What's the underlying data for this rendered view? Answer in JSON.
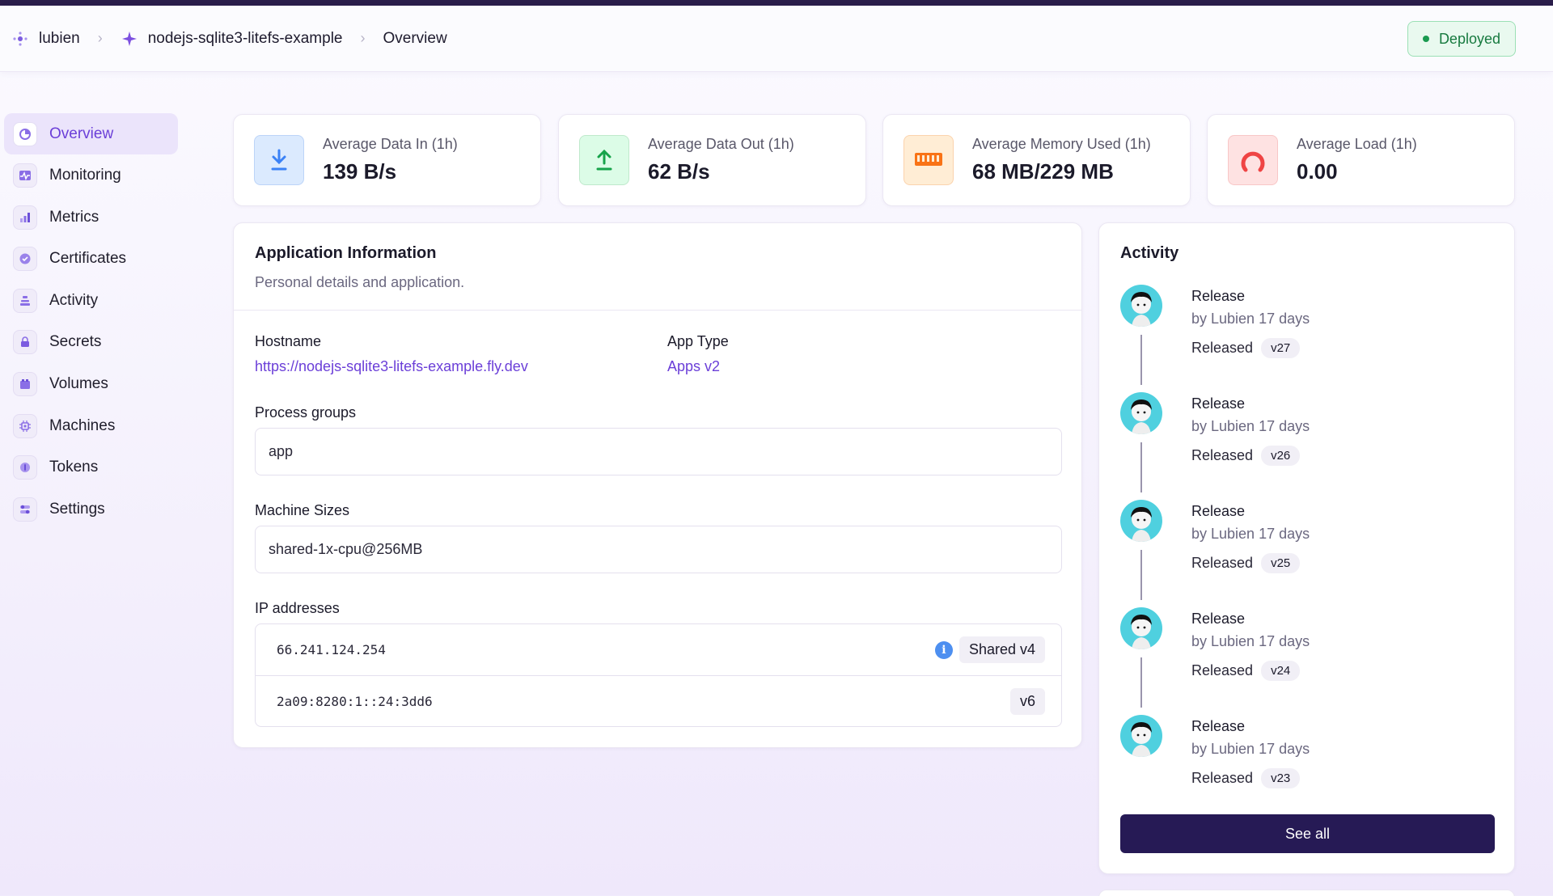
{
  "header": {
    "breadcrumbs": [
      {
        "label": "lubien",
        "icon": "org-icon"
      },
      {
        "label": "nodejs-sqlite3-litefs-example",
        "icon": "sparkle-icon"
      },
      {
        "label": "Overview"
      }
    ],
    "status": "Deployed",
    "status_color": "#1a9a50"
  },
  "sidebar": {
    "items": [
      {
        "label": "Overview",
        "icon": "overview-icon",
        "active": true
      },
      {
        "label": "Monitoring",
        "icon": "monitoring-icon"
      },
      {
        "label": "Metrics",
        "icon": "metrics-icon"
      },
      {
        "label": "Certificates",
        "icon": "certificate-icon"
      },
      {
        "label": "Activity",
        "icon": "activity-icon"
      },
      {
        "label": "Secrets",
        "icon": "lock-icon"
      },
      {
        "label": "Volumes",
        "icon": "volume-icon"
      },
      {
        "label": "Machines",
        "icon": "cpu-icon"
      },
      {
        "label": "Tokens",
        "icon": "token-icon"
      },
      {
        "label": "Settings",
        "icon": "settings-icon"
      }
    ]
  },
  "stats": [
    {
      "label": "Average Data In (1h)",
      "value": "139 B/s",
      "icon": "download-icon",
      "color": "#3b82f6"
    },
    {
      "label": "Average Data Out (1h)",
      "value": "62 B/s",
      "icon": "upload-icon",
      "color": "#16a34a"
    },
    {
      "label": "Average Memory Used (1h)",
      "value": "68 MB/229 MB",
      "icon": "memory-icon",
      "color": "#f97316"
    },
    {
      "label": "Average Load (1h)",
      "value": "0.00",
      "icon": "gauge-icon",
      "color": "#ef4444"
    }
  ],
  "app_info": {
    "title": "Application Information",
    "subtitle": "Personal details and application.",
    "hostname_label": "Hostname",
    "hostname": "https://nodejs-sqlite3-litefs-example.fly.dev",
    "app_type_label": "App Type",
    "app_type": "Apps v2",
    "process_groups_label": "Process groups",
    "process_groups": "app",
    "machine_sizes_label": "Machine Sizes",
    "machine_sizes": "shared-1x-cpu@256MB",
    "ip_label": "IP addresses",
    "ips": [
      {
        "address": "66.241.124.254",
        "type": "Shared v4"
      },
      {
        "address": "2a09:8280:1::24:3dd6",
        "type": "v6"
      }
    ]
  },
  "activity": {
    "title": "Activity",
    "items": [
      {
        "name": "Release",
        "by": "by Lubien 17 days",
        "released": "Released",
        "version": "v27"
      },
      {
        "name": "Release",
        "by": "by Lubien 17 days",
        "released": "Released",
        "version": "v26"
      },
      {
        "name": "Release",
        "by": "by Lubien 17 days",
        "released": "Released",
        "version": "v25"
      },
      {
        "name": "Release",
        "by": "by Lubien 17 days",
        "released": "Released",
        "version": "v24"
      },
      {
        "name": "Release",
        "by": "by Lubien 17 days",
        "released": "Released",
        "version": "v23"
      }
    ],
    "see_all": "See all"
  }
}
